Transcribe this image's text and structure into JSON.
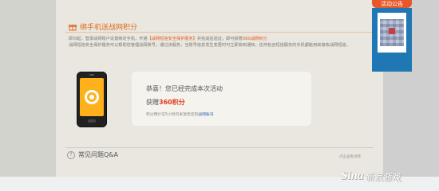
{
  "header": {
    "notice_tab": "活动公告"
  },
  "section": {
    "title": "绑手机送战网积分",
    "desc_line1_a": "即日起，登录战网账户设置绑定手机，开通",
    "desc_line1_hl": "【战网短信安全保护服务】",
    "desc_line1_b": "并完成后验证，即可获赠",
    "desc_line1_pts": "360战网积分",
    "desc_line2": "战网短信安全保护服务可以帮助您管理战网账号，通过该服务，当账号信息发生变更时可立即收到通知，任何包含短信服务的手机都能用来接收战网短信。"
  },
  "result": {
    "congrats": "恭喜！您已经完成本次活动",
    "gain_prefix": "获赠",
    "gain_points": "360积分",
    "note_prefix": "积分预计在5小时内发放至您的",
    "note_link": "战网账号"
  },
  "faq": {
    "title": "常见问题Q&A",
    "more": "点击查看详情"
  },
  "footer": {
    "brand": "Sina",
    "brand_cn": "新浪游戏"
  }
}
